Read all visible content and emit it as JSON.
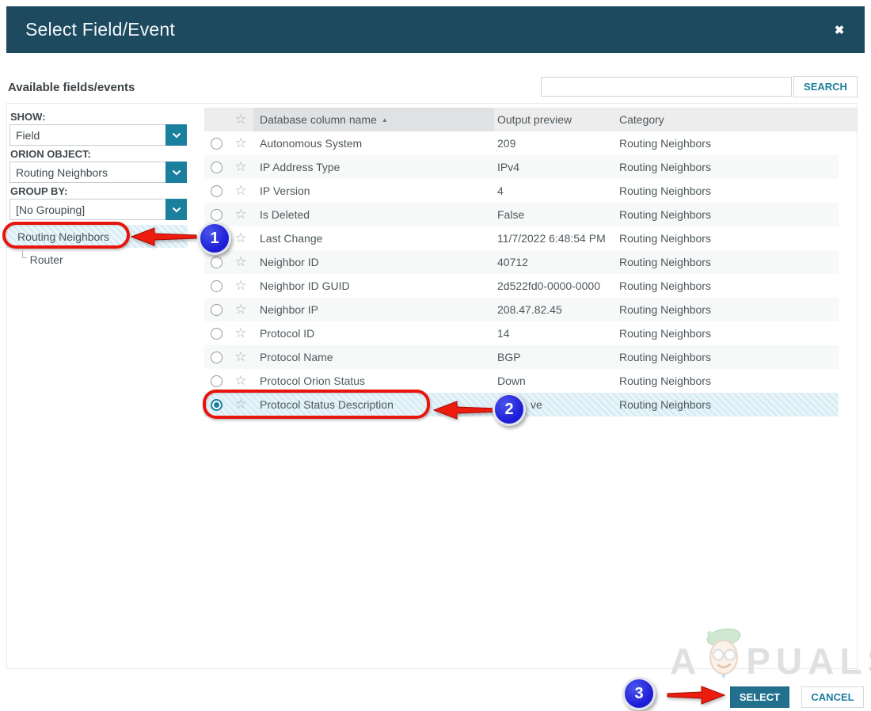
{
  "colors": {
    "header_bg": "#1d4a5f",
    "accent_teal": "#1b7f9e",
    "select_button_bg": "#21708e",
    "annotation_red": "#e8150c",
    "annotation_blue": "#1d1dd8",
    "selected_row_bg": "#ddeef7",
    "table_header_bg": "#ededee",
    "sorted_column_bg": "#e0e1e2"
  },
  "icons": {
    "close": "✖",
    "sort_asc": "▲",
    "star": "☆",
    "tree_connector": "└"
  },
  "dialog": {
    "title": "Select Field/Event"
  },
  "heading": "Available fields/events",
  "search": {
    "value": "",
    "button_label": "SEARCH"
  },
  "sidebar": {
    "show_label": "SHOW:",
    "show_value": "Field",
    "orion_object_label": "ORION OBJECT:",
    "orion_object_value": "Routing Neighbors",
    "group_by_label": "GROUP BY:",
    "group_by_value": "[No Grouping]",
    "tree_selected": "Routing Neighbors",
    "tree_child": "Router"
  },
  "table": {
    "headers": {
      "name": "Database column name",
      "preview": "Output preview",
      "category": "Category"
    },
    "sort": {
      "column": "Database column name",
      "direction": "ascending"
    },
    "rows": [
      {
        "name": "Autonomous System",
        "preview": "209",
        "category": "Routing Neighbors",
        "selected": false
      },
      {
        "name": "IP Address Type",
        "preview": "IPv4",
        "category": "Routing Neighbors",
        "selected": false
      },
      {
        "name": "IP Version",
        "preview": "4",
        "category": "Routing Neighbors",
        "selected": false
      },
      {
        "name": "Is Deleted",
        "preview": "False",
        "category": "Routing Neighbors",
        "selected": false
      },
      {
        "name": "Last Change",
        "preview": "11/7/2022 6:48:54 PM",
        "category": "Routing Neighbors",
        "selected": false
      },
      {
        "name": "Neighbor ID",
        "preview": "40712",
        "category": "Routing Neighbors",
        "selected": false
      },
      {
        "name": "Neighbor ID GUID",
        "preview": "2d522fd0-0000-0000",
        "category": "Routing Neighbors",
        "selected": false
      },
      {
        "name": "Neighbor IP",
        "preview": "208.47.82.45",
        "category": "Routing Neighbors",
        "selected": false
      },
      {
        "name": "Protocol ID",
        "preview": "14",
        "category": "Routing Neighbors",
        "selected": false
      },
      {
        "name": "Protocol Name",
        "preview": "BGP",
        "category": "Routing Neighbors",
        "selected": false
      },
      {
        "name": "Protocol Orion Status",
        "preview": "Down",
        "category": "Routing Neighbors",
        "selected": false
      },
      {
        "name": "Protocol Status Description",
        "preview": "ve",
        "category": "Routing Neighbors",
        "selected": true
      }
    ]
  },
  "annotations": {
    "step1_label": "1",
    "step2_label": "2",
    "step3_label": "3"
  },
  "footer": {
    "select_label": "SELECT",
    "cancel_label": "CANCEL"
  },
  "watermark": {
    "prefix": "A",
    "suffix": "PUALS"
  }
}
